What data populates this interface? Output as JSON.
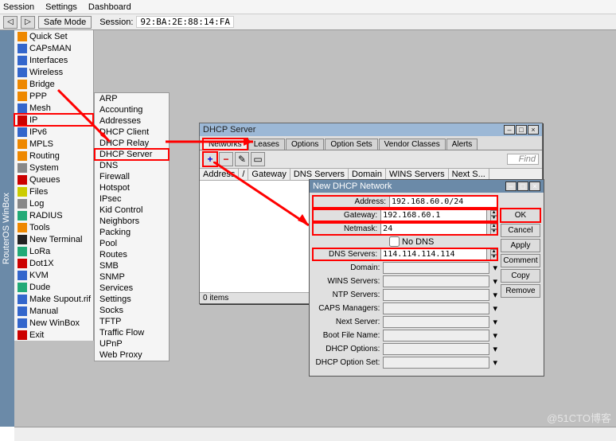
{
  "menubar": [
    "Session",
    "Settings",
    "Dashboard"
  ],
  "toolbar": {
    "safe_mode": "Safe Mode",
    "session_label": "Session:",
    "session_value": "92:BA:2E:88:14:FA"
  },
  "vert_title": "RouterOS WinBox",
  "sidebar": [
    {
      "label": "Quick Set",
      "ic": "ic-ora"
    },
    {
      "label": "CAPsMAN",
      "ic": "ic-blu"
    },
    {
      "label": "Interfaces",
      "ic": "ic-blu"
    },
    {
      "label": "Wireless",
      "ic": "ic-blu"
    },
    {
      "label": "Bridge",
      "ic": "ic-ora"
    },
    {
      "label": "PPP",
      "ic": "ic-ora"
    },
    {
      "label": "Mesh",
      "ic": "ic-blu"
    },
    {
      "label": "IP",
      "ic": "ic-red",
      "hl": true
    },
    {
      "label": "IPv6",
      "ic": "ic-blu"
    },
    {
      "label": "MPLS",
      "ic": "ic-ora"
    },
    {
      "label": "Routing",
      "ic": "ic-ora"
    },
    {
      "label": "System",
      "ic": "ic-gry"
    },
    {
      "label": "Queues",
      "ic": "ic-red"
    },
    {
      "label": "Files",
      "ic": "ic-yel"
    },
    {
      "label": "Log",
      "ic": "ic-gry"
    },
    {
      "label": "RADIUS",
      "ic": "ic-grn"
    },
    {
      "label": "Tools",
      "ic": "ic-ora"
    },
    {
      "label": "New Terminal",
      "ic": "ic-blk"
    },
    {
      "label": "LoRa",
      "ic": "ic-grn"
    },
    {
      "label": "Dot1X",
      "ic": "ic-red"
    },
    {
      "label": "KVM",
      "ic": "ic-blu"
    },
    {
      "label": "Dude",
      "ic": "ic-grn"
    },
    {
      "label": "Make Supout.rif",
      "ic": "ic-blu"
    },
    {
      "label": "Manual",
      "ic": "ic-blu"
    },
    {
      "label": "New WinBox",
      "ic": "ic-blu"
    },
    {
      "label": "Exit",
      "ic": "ic-red"
    }
  ],
  "submenu": [
    "ARP",
    "Accounting",
    "Addresses",
    "DHCP Client",
    "DHCP Relay",
    "DHCP Server",
    "DNS",
    "Firewall",
    "Hotspot",
    "IPsec",
    "Kid Control",
    "Neighbors",
    "Packing",
    "Pool",
    "Routes",
    "SMB",
    "SNMP",
    "Services",
    "Settings",
    "Socks",
    "TFTP",
    "Traffic Flow",
    "UPnP",
    "Web Proxy"
  ],
  "submenu_hl_index": 5,
  "dhcp_server": {
    "title": "DHCP Server",
    "tabs": [
      "Networks",
      "Leases",
      "Options",
      "Option Sets",
      "Vendor Classes",
      "Alerts"
    ],
    "tab_hl_index": 0,
    "find": "Find",
    "columns": [
      "Address",
      "/",
      "Gateway",
      "DNS Servers",
      "Domain",
      "WINS Servers",
      "Next S..."
    ],
    "status": "0 items"
  },
  "dhcp_network": {
    "title": "New DHCP Network",
    "fields": {
      "address_lbl": "Address:",
      "address": "192.168.60.0/24",
      "gateway_lbl": "Gateway:",
      "gateway": "192.168.60.1",
      "netmask_lbl": "Netmask:",
      "netmask": "24",
      "no_dns": "No DNS",
      "dns_lbl": "DNS Servers:",
      "dns": "114.114.114.114",
      "domain_lbl": "Domain:",
      "wins_lbl": "WINS Servers:",
      "ntp_lbl": "NTP Servers:",
      "caps_lbl": "CAPS Managers:",
      "next_lbl": "Next Server:",
      "boot_lbl": "Boot File Name:",
      "opts_lbl": "DHCP Options:",
      "optset_lbl": "DHCP Option Set:"
    },
    "buttons": {
      "ok": "OK",
      "cancel": "Cancel",
      "apply": "Apply",
      "comment": "Comment",
      "copy": "Copy",
      "remove": "Remove"
    }
  },
  "watermark": "@51CTO博客"
}
